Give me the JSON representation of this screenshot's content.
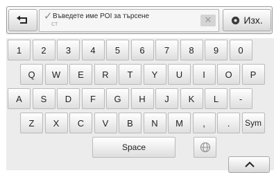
{
  "input_bar": {
    "placeholder": "Въведете име POI за търсене",
    "cursor_label": "CT",
    "clear_glyph": "✕",
    "exit_label": "Изх.",
    "back_icon": "back-arrow-icon",
    "exit_icon": "gear-icon"
  },
  "keyboard": {
    "rows": [
      [
        "1",
        "2",
        "3",
        "4",
        "5",
        "6",
        "7",
        "8",
        "9",
        "0"
      ],
      [
        "Q",
        "W",
        "E",
        "R",
        "T",
        "Y",
        "U",
        "I",
        "O",
        "P"
      ],
      [
        "A",
        "S",
        "D",
        "F",
        "G",
        "H",
        "J",
        "K",
        "L",
        "-"
      ],
      [
        "Z",
        "X",
        "C",
        "V",
        "B",
        "N",
        "M",
        ",",
        ".",
        "Sym"
      ]
    ],
    "space_label": "Space",
    "language_icon": "globe-icon",
    "hide_icon": "chevron-up-icon"
  }
}
